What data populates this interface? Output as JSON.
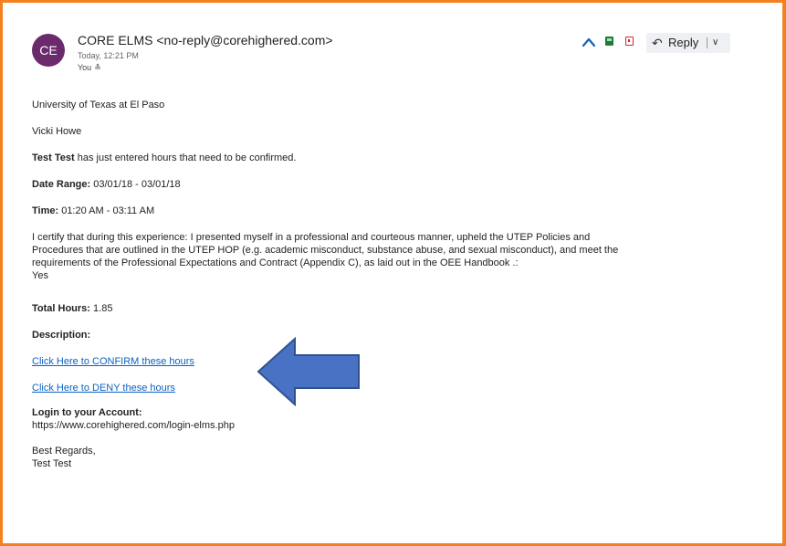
{
  "header": {
    "avatar_initials": "CE",
    "sender": "CORE ELMS <no-reply@corehighered.com>",
    "time": "Today, 12:21 PM",
    "recipient": "You",
    "reply_label": "Reply"
  },
  "colors": {
    "frame_border": "#f4811f",
    "avatar_bg": "#6b2a6b",
    "link": "#0b63c4",
    "arrow_fill": "#4a72c4",
    "arrow_stroke": "#2f528f"
  },
  "icons": [
    "collapse-up-icon",
    "green-flag-icon",
    "red-flag-icon",
    "reply-arrow-icon",
    "chevron-down-icon"
  ],
  "body": {
    "institution": "University of Texas at El Paso",
    "recipient_name": "Vicki Howe",
    "entered_bold": "Test Test",
    "entered_rest": " has just entered hours that need to be confirmed.",
    "date_label": "Date Range:",
    "date_value": " 03/01/18 - 03/01/18",
    "time_label": "Time:",
    "time_value": " 01:20 AM - 03:11 AM",
    "certify_line1": "I certify that during this experience: I presented myself in a professional and courteous manner, upheld the UTEP Policies and",
    "certify_line2": "Procedures that are outlined in the UTEP HOP (e.g. academic misconduct, substance abuse, and sexual misconduct), and meet the",
    "certify_line3": "requirements of the Professional Expectations and Contract (Appendix C), as laid out in the OEE Handbook .:",
    "certify_answer": "Yes",
    "total_label": "Total Hours:",
    "total_value": " 1.85",
    "description_label": "Description:",
    "confirm_link": "Click Here to CONFIRM these hours",
    "deny_link": "Click Here to DENY these hours",
    "login_label": "Login to your Account:",
    "login_url": "https://www.corehighered.com/login-elms.php",
    "regards": "Best Regards,",
    "signature": "Test Test"
  }
}
